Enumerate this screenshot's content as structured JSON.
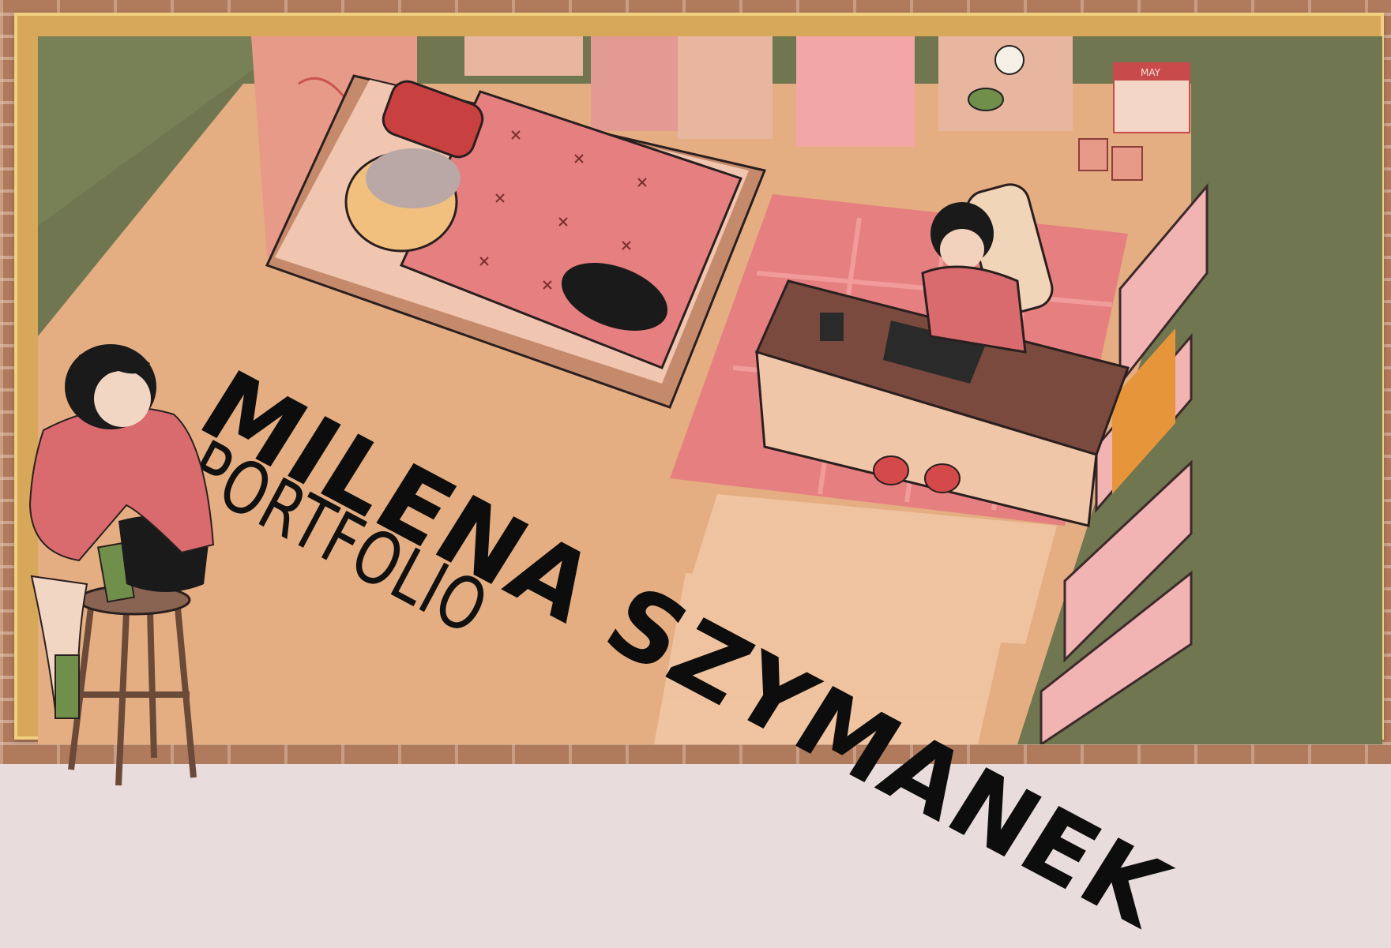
{
  "title": {
    "name": "MILENA SZYMANEK",
    "subtitle": "PORTFOLIO"
  },
  "calendar": {
    "month": "MAY"
  },
  "colors": {
    "wall": "#6f7650",
    "floor": "#e4ae82",
    "bed_blanket": "#e67f7f",
    "frame": "#d7a85a",
    "brick": "#b07a5c",
    "sweater": "#d96a6e"
  }
}
